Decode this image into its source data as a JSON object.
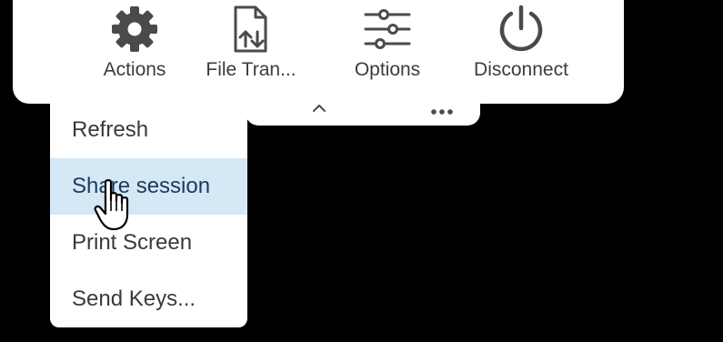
{
  "toolbar": {
    "items": [
      {
        "label": "Actions",
        "icon": "gear-icon"
      },
      {
        "label": "File Tran...",
        "icon": "file-transfer-icon"
      },
      {
        "label": "Options",
        "icon": "sliders-icon"
      },
      {
        "label": "Disconnect",
        "icon": "power-icon"
      }
    ],
    "collapse_icon": "caret-up-icon",
    "more_icon": "ellipsis-icon"
  },
  "menu": {
    "items": [
      {
        "label": "Refresh"
      },
      {
        "label": "Share session",
        "state": "hovered"
      },
      {
        "label": "Print Screen"
      },
      {
        "label": "Send Keys..."
      }
    ]
  },
  "colors": {
    "background": "#000000",
    "panel": "#ffffff",
    "icon": "#4a4a4a",
    "hover_highlight": "#d4e8f6"
  }
}
